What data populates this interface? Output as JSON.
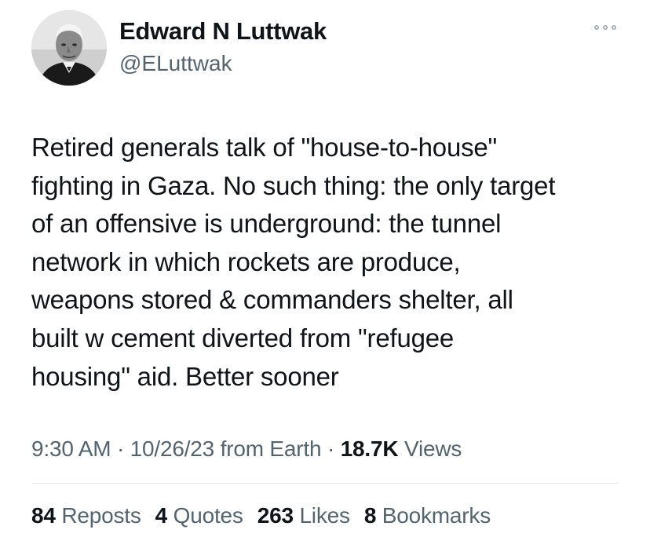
{
  "author": {
    "name": "Edward N Luttwak",
    "handle": "@ELuttwak"
  },
  "tweet": {
    "text": "Retired generals talk of \"house-to-house\"\nfighting in Gaza. No such thing: the only target\nof an offensive is  underground: the tunnel\nnetwork in which rockets are produce,\nweapons stored & commanders shelter, all\nbuilt w cement diverted from \"refugee\nhousing\" aid. Better sooner",
    "time": "9:30 AM",
    "date": "10/26/23",
    "source": "from Earth",
    "separator": "·",
    "views_count": "18.7K",
    "views_label": "Views"
  },
  "stats": {
    "reposts_count": "84",
    "reposts_label": "Reposts",
    "quotes_count": "4",
    "quotes_label": "Quotes",
    "likes_count": "263",
    "likes_label": "Likes",
    "bookmarks_count": "8",
    "bookmarks_label": "Bookmarks"
  },
  "icons": {
    "more": "more-horizontal-icon"
  },
  "colors": {
    "text_primary": "#0f1419",
    "text_secondary": "#536471",
    "divider": "#e5e7ea"
  }
}
